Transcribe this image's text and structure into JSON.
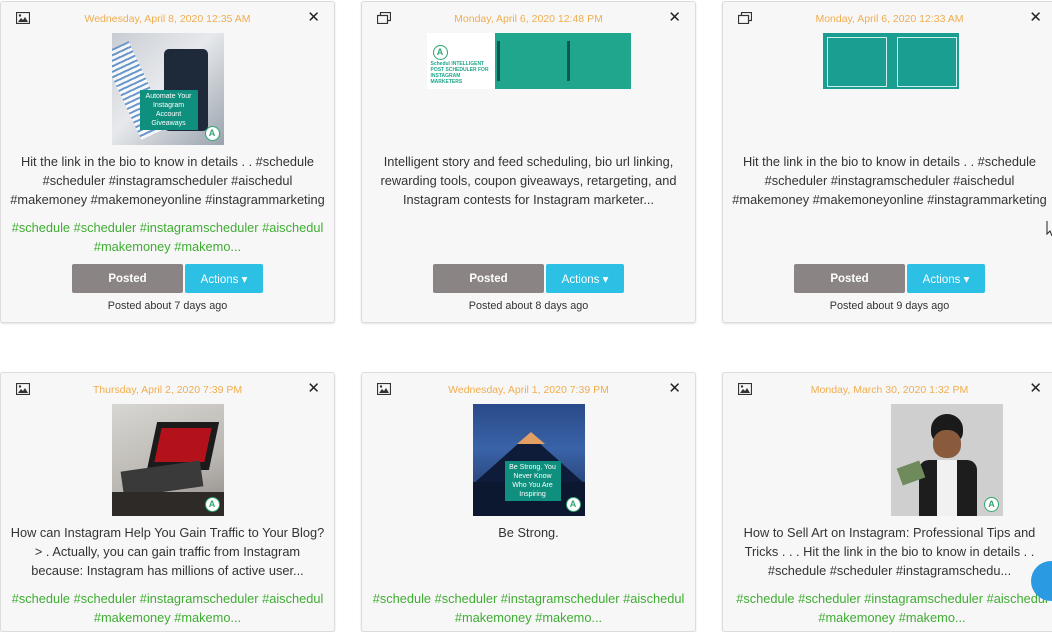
{
  "cards": [
    {
      "date": "Wednesday, April 8, 2020 12:35 AM",
      "type_icon": "image-icon",
      "caption": "Hit the link in the bio to know in details . . #schedule #scheduler #instagramscheduler #aischedul #makemoney #makemoneyonline #instagrammarketing",
      "tags": "#schedule #scheduler #instagramscheduler #aischedul #makemoney #makemo...",
      "image_text": "Automate Your Instagram Account Giveaways",
      "posted_label": "Posted",
      "actions_label": "Actions ▾",
      "posted_ago": "Posted about 7 days ago"
    },
    {
      "date": "Monday, April 6, 2020 12:48 PM",
      "type_icon": "carousel-icon",
      "caption": "Intelligent story and feed scheduling, bio url linking, rewarding tools, coupon giveaways, retargeting, and Instagram contests for Instagram marketer...",
      "tags": "",
      "image_text": "Schedul INTELLIGENT POST SCHEDULER FOR INSTAGRAM MARKETERS",
      "posted_label": "Posted",
      "actions_label": "Actions ▾",
      "posted_ago": "Posted about 8 days ago"
    },
    {
      "date": "Monday, April 6, 2020 12:33 AM",
      "type_icon": "carousel-icon",
      "caption": "Hit the link in the bio to know in details . . #schedule #scheduler #instagramscheduler #aischedul #makemoney #makemoneyonline #instagrammarketing",
      "tags": "",
      "image_text": "",
      "posted_label": "Posted",
      "actions_label": "Actions ▾",
      "posted_ago": "Posted about 9 days ago"
    },
    {
      "date": "Thursday, April 2, 2020 7:39 PM",
      "type_icon": "image-icon",
      "caption": "How can Instagram Help You Gain Traffic to Your Blog?> . Actually, you can gain traffic from Instagram because: Instagram has millions of active user...",
      "tags": "#schedule #scheduler #instagramscheduler #aischedul #makemoney #makemo...",
      "image_text": ""
    },
    {
      "date": "Wednesday, April 1, 2020 7:39 PM",
      "type_icon": "image-icon",
      "caption": "Be Strong.",
      "tags": "#schedule #scheduler #instagramscheduler #aischedul #makemoney #makemo...",
      "image_text": "Be Strong, You Never Know Who You Are Inspiring"
    },
    {
      "date": "Monday, March 30, 2020 1:32 PM",
      "type_icon": "image-icon",
      "caption": "How to Sell Art on Instagram: Professional Tips and Tricks . . . Hit the link in the bio to know in details . . #schedule #scheduler #instagramschedu...",
      "tags": "#schedule #scheduler #instagramscheduler #aischedul #makemoney #makemo...",
      "image_text": ""
    }
  ],
  "colors": {
    "date": "#f0ad4e",
    "tags": "#3fad32",
    "posted_button": "#8a8484",
    "actions_button": "#2bc0e4"
  }
}
